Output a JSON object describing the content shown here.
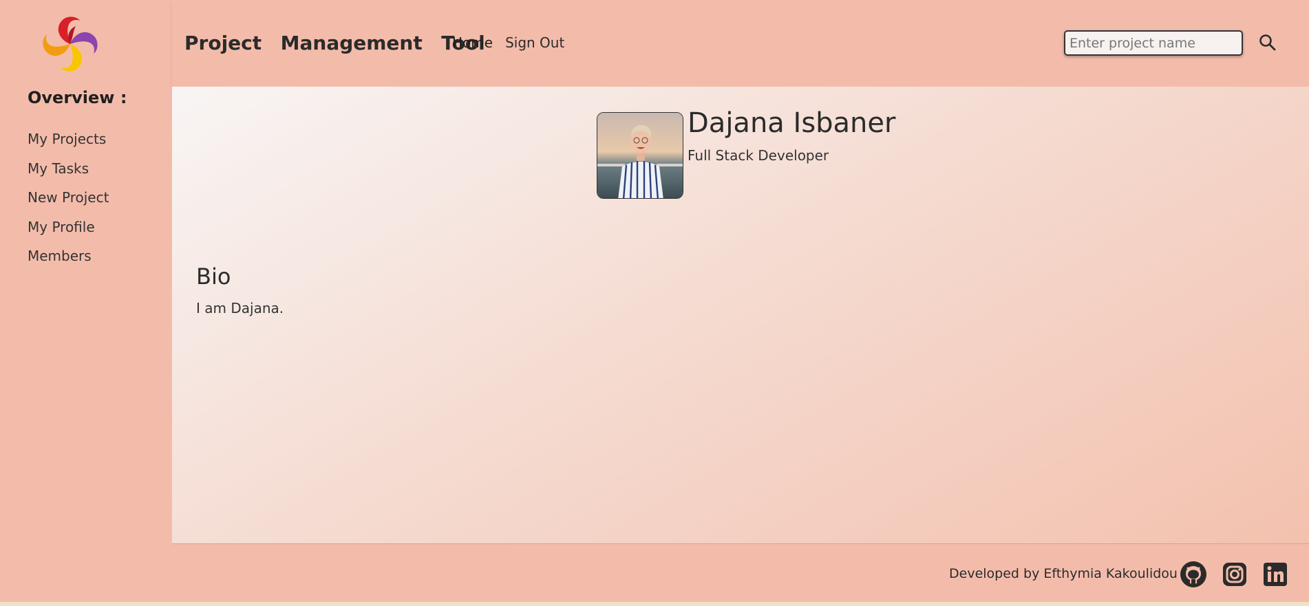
{
  "sidebar": {
    "overview_title": "Overview :",
    "items": [
      {
        "label": "My Projects"
      },
      {
        "label": "My Tasks"
      },
      {
        "label": "New Project"
      },
      {
        "label": "My Profile"
      },
      {
        "label": "Members"
      }
    ]
  },
  "header": {
    "app_title": "Project  Management  Tool",
    "nav": [
      {
        "label": "Home"
      },
      {
        "label": "Sign Out"
      }
    ],
    "search": {
      "placeholder": "Enter project name",
      "value": "",
      "icon": "search-icon"
    }
  },
  "profile": {
    "name": "Dajana Isbaner",
    "role": "Full Stack Developer",
    "avatar_icon": "profile-photo"
  },
  "bio": {
    "title": "Bio",
    "text": "I am Dajana."
  },
  "footer": {
    "credit": "Developed by Efthymia Kakoulidou",
    "social_icons": [
      "github-icon",
      "instagram-icon",
      "linkedin-icon"
    ]
  },
  "colors": {
    "background": "#f3bcaa",
    "text": "#2b2b2b",
    "logo_red": "#d81f2a",
    "logo_purple": "#8e44ad",
    "logo_orange": "#f39c12",
    "logo_yellow": "#f7c600"
  }
}
